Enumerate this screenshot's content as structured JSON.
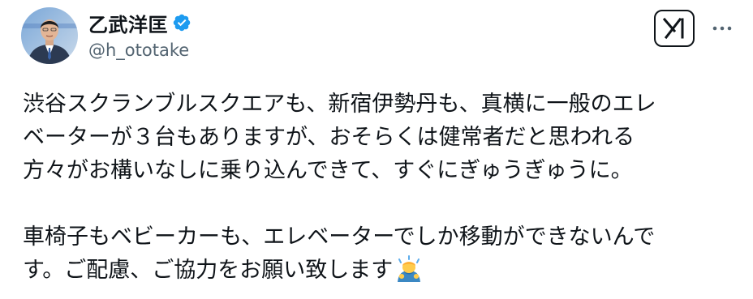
{
  "author": {
    "display_name": "乙武洋匡",
    "handle": "@h_ototake",
    "verified_icon": "verified-badge-icon",
    "avatar_icon": "avatar"
  },
  "actions": {
    "grok_icon": "grok-icon",
    "more_icon": "more-options-icon"
  },
  "post": {
    "paragraph_1": [
      "渋谷スクランブルスクエアも、新宿伊勢丹も、真横に一般のエレ",
      "ベーターが３台もありますが、おそらくは健常者だと思われる",
      "方々がお構いなしに乗り込んできて、すぐにぎゅうぎゅうに。"
    ],
    "paragraph_2": [
      "車椅子もベビーカーも、エレベーターでしか移動ができないんで",
      "す。ご配慮、ご協力をお願い致します"
    ],
    "trailing_emoji": "bowing-person-emoji"
  },
  "colors": {
    "text": "#0f1419",
    "secondary_text": "#536471",
    "verified_blue": "#1d9bf0"
  }
}
